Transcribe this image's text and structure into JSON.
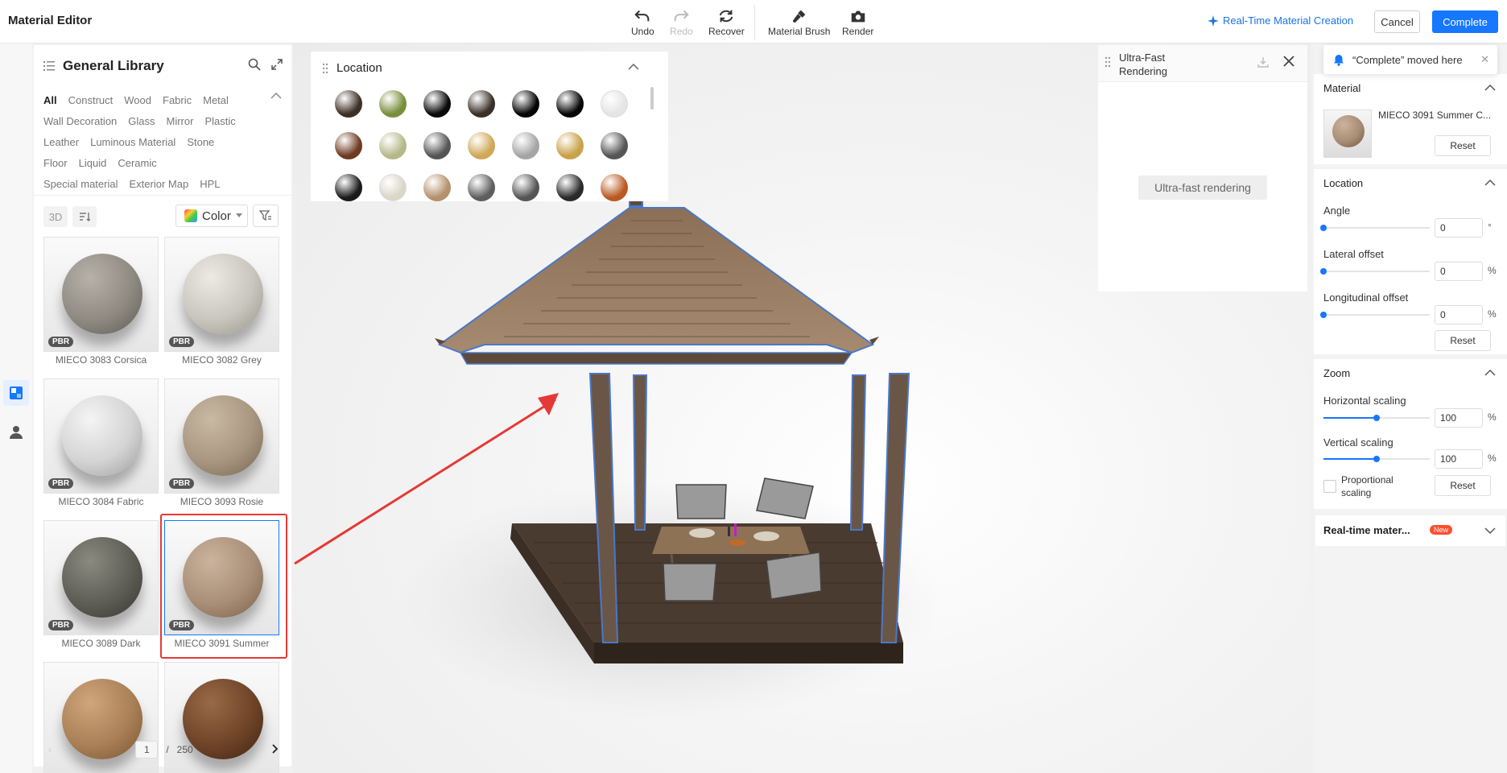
{
  "header": {
    "title": "Material Editor",
    "tools": {
      "undo": "Undo",
      "redo": "Redo",
      "recover": "Recover",
      "material_brush": "Material Brush",
      "render": "Render"
    },
    "realtime_link": "Real-Time Material Creation",
    "cancel": "Cancel",
    "complete": "Complete"
  },
  "library": {
    "title": "General Library",
    "categories": [
      "All",
      "Construct",
      "Wood",
      "Fabric",
      "Metal",
      "Wall Decoration",
      "Glass",
      "Mirror",
      "Plastic",
      "Leather",
      "Luminous Material",
      "Stone",
      "Floor",
      "Liquid",
      "Ceramic",
      "Special material",
      "Exterior Map",
      "HPL"
    ],
    "selected_category": "All",
    "btn_3d": "3D",
    "color_filter": "Color",
    "materials": [
      {
        "name": "MIECO 3083 Corsica",
        "badge": "PBR",
        "color": "#8f8a82"
      },
      {
        "name": "MIECO 3082 Grey",
        "badge": "PBR",
        "color": "#c8c6bd"
      },
      {
        "name": "MIECO 3084 Fabric",
        "badge": "PBR",
        "color": "#d4d4d4"
      },
      {
        "name": "MIECO 3093 Rosie",
        "badge": "PBR",
        "color": "#a89680"
      },
      {
        "name": "MIECO 3089 Dark",
        "badge": "PBR",
        "color": "#5e5e56"
      },
      {
        "name": "MIECO 3091 Summer",
        "badge": "PBR",
        "color": "#a98f78"
      },
      {
        "name": "",
        "badge": "",
        "color": "#a98057"
      },
      {
        "name": "",
        "badge": "",
        "color": "#6e4428"
      }
    ],
    "pager": {
      "current": "1",
      "separator": "/",
      "total": "250"
    }
  },
  "location_panel": {
    "title": "Location",
    "swatches": [
      "#3e3025",
      "#7a8f3c",
      "#0a0a0a",
      "#3b3028",
      "#050505",
      "#060606",
      "#e5e5e5",
      "#6e3a22",
      "#b5b989",
      "#555555",
      "#cfa858",
      "#a5a5a5",
      "#c9a148",
      "#555555",
      "#1a1a1a",
      "#dad7c8",
      "#b4906c",
      "#5e5e5e",
      "#555555",
      "#2a2a2a",
      "#b95a22"
    ]
  },
  "ultrafast": {
    "title": "Ultra-Fast Rendering",
    "button": "Ultra-fast rendering"
  },
  "toast": {
    "text": "“Complete”  moved here"
  },
  "properties": {
    "material": {
      "title": "Material",
      "name": "MIECO 3091 Summer C...",
      "reset": "Reset",
      "color": "#a88d75"
    },
    "location": {
      "title": "Location",
      "angle_label": "Angle",
      "angle_value": "0",
      "angle_unit": "°",
      "lateral_label": "Lateral offset",
      "lateral_value": "0",
      "lateral_unit": "%",
      "longitudinal_label": "Longitudinal offset",
      "longitudinal_value": "0",
      "longitudinal_unit": "%",
      "reset": "Reset"
    },
    "zoom": {
      "title": "Zoom",
      "horizontal_label": "Horizontal scaling",
      "horizontal_value": "100",
      "horizontal_unit": "%",
      "horizontal_fraction": 0.5,
      "vertical_label": "Vertical scaling",
      "vertical_value": "100",
      "vertical_unit": "%",
      "vertical_fraction": 0.5,
      "proportional_label": "Proportional scaling",
      "reset": "Reset"
    },
    "realtime": {
      "title": "Real-time mater...",
      "badge": "New"
    }
  },
  "colors": {
    "accent": "#1677ff",
    "highlight": "#e53935"
  }
}
